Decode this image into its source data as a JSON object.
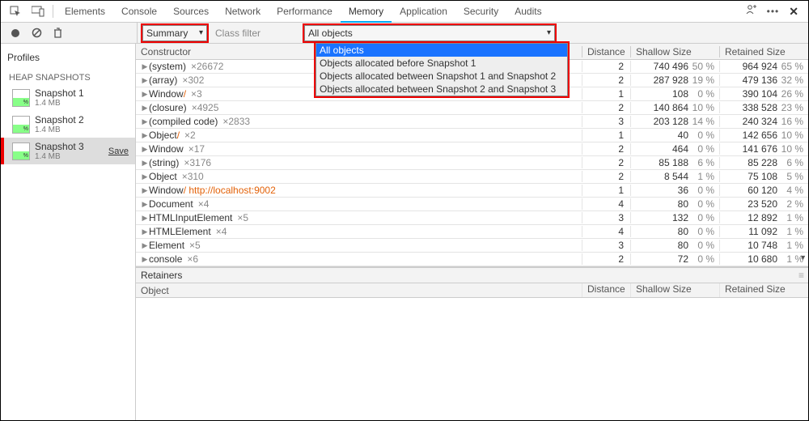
{
  "tabs": [
    "Elements",
    "Console",
    "Sources",
    "Network",
    "Performance",
    "Memory",
    "Application",
    "Security",
    "Audits"
  ],
  "active_tab": "Memory",
  "toolbar": {
    "summary_label": "Summary",
    "class_filter_placeholder": "Class filter",
    "filter_value": "All objects"
  },
  "dropdown_options": [
    "All objects",
    "Objects allocated before Snapshot 1",
    "Objects allocated between Snapshot 1 and Snapshot 2",
    "Objects allocated between Snapshot 2 and Snapshot 3"
  ],
  "dropdown_selected_index": 0,
  "sidebar": {
    "title": "Profiles",
    "group": "HEAP SNAPSHOTS",
    "snapshots": [
      {
        "title": "Snapshot 1",
        "sub": "1.4 MB",
        "selected": false,
        "save": false
      },
      {
        "title": "Snapshot 2",
        "sub": "1.4 MB",
        "selected": false,
        "save": false
      },
      {
        "title": "Snapshot 3",
        "sub": "1.4 MB",
        "selected": true,
        "save": true
      }
    ],
    "save_label": "Save"
  },
  "columns": {
    "constructor": "Constructor",
    "distance": "Distance",
    "shallow": "Shallow Size",
    "retained": "Retained Size"
  },
  "rows": [
    {
      "name": "(system)",
      "count": "×26672",
      "dist": "2",
      "shallow": "740 496",
      "spct": "50 %",
      "retained": "964 924",
      "rpct": "65 %"
    },
    {
      "name": "(array)",
      "count": "×302",
      "dist": "2",
      "shallow": "287 928",
      "spct": "19 %",
      "retained": "479 136",
      "rpct": "32 %"
    },
    {
      "name": "Window",
      "suffix": " / ",
      "count": "×3",
      "dist": "1",
      "shallow": "108",
      "spct": "0 %",
      "retained": "390 104",
      "rpct": "26 %"
    },
    {
      "name": "(closure)",
      "count": "×4925",
      "dist": "2",
      "shallow": "140 864",
      "spct": "10 %",
      "retained": "338 528",
      "rpct": "23 %"
    },
    {
      "name": "(compiled code)",
      "count": "×2833",
      "dist": "3",
      "shallow": "203 128",
      "spct": "14 %",
      "retained": "240 324",
      "rpct": "16 %"
    },
    {
      "name": "Object",
      "suffix": " / ",
      "count": "×2",
      "dist": "1",
      "shallow": "40",
      "spct": "0 %",
      "retained": "142 656",
      "rpct": "10 %"
    },
    {
      "name": "Window",
      "count": "×17",
      "dist": "2",
      "shallow": "464",
      "spct": "0 %",
      "retained": "141 676",
      "rpct": "10 %"
    },
    {
      "name": "(string)",
      "count": "×3176",
      "dist": "2",
      "shallow": "85 188",
      "spct": "6 %",
      "retained": "85 228",
      "rpct": "6 %"
    },
    {
      "name": "Object",
      "count": "×310",
      "dist": "2",
      "shallow": "8 544",
      "spct": "1 %",
      "retained": "75 108",
      "rpct": "5 %"
    },
    {
      "name": "Window",
      "suffix": " / http://localhost:9002",
      "count": "",
      "dist": "1",
      "shallow": "36",
      "spct": "0 %",
      "retained": "60 120",
      "rpct": "4 %"
    },
    {
      "name": "Document",
      "count": "×4",
      "dist": "4",
      "shallow": "80",
      "spct": "0 %",
      "retained": "23 520",
      "rpct": "2 %"
    },
    {
      "name": "HTMLInputElement",
      "count": "×5",
      "dist": "3",
      "shallow": "132",
      "spct": "0 %",
      "retained": "12 892",
      "rpct": "1 %"
    },
    {
      "name": "HTMLElement",
      "count": "×4",
      "dist": "4",
      "shallow": "80",
      "spct": "0 %",
      "retained": "11 092",
      "rpct": "1 %"
    },
    {
      "name": "Element",
      "count": "×5",
      "dist": "3",
      "shallow": "80",
      "spct": "0 %",
      "retained": "10 748",
      "rpct": "1 %"
    },
    {
      "name": "console",
      "count": "×6",
      "dist": "2",
      "shallow": "72",
      "spct": "0 %",
      "retained": "10 680",
      "rpct": "1 %"
    }
  ],
  "retainers": {
    "title": "Retainers",
    "object": "Object"
  }
}
